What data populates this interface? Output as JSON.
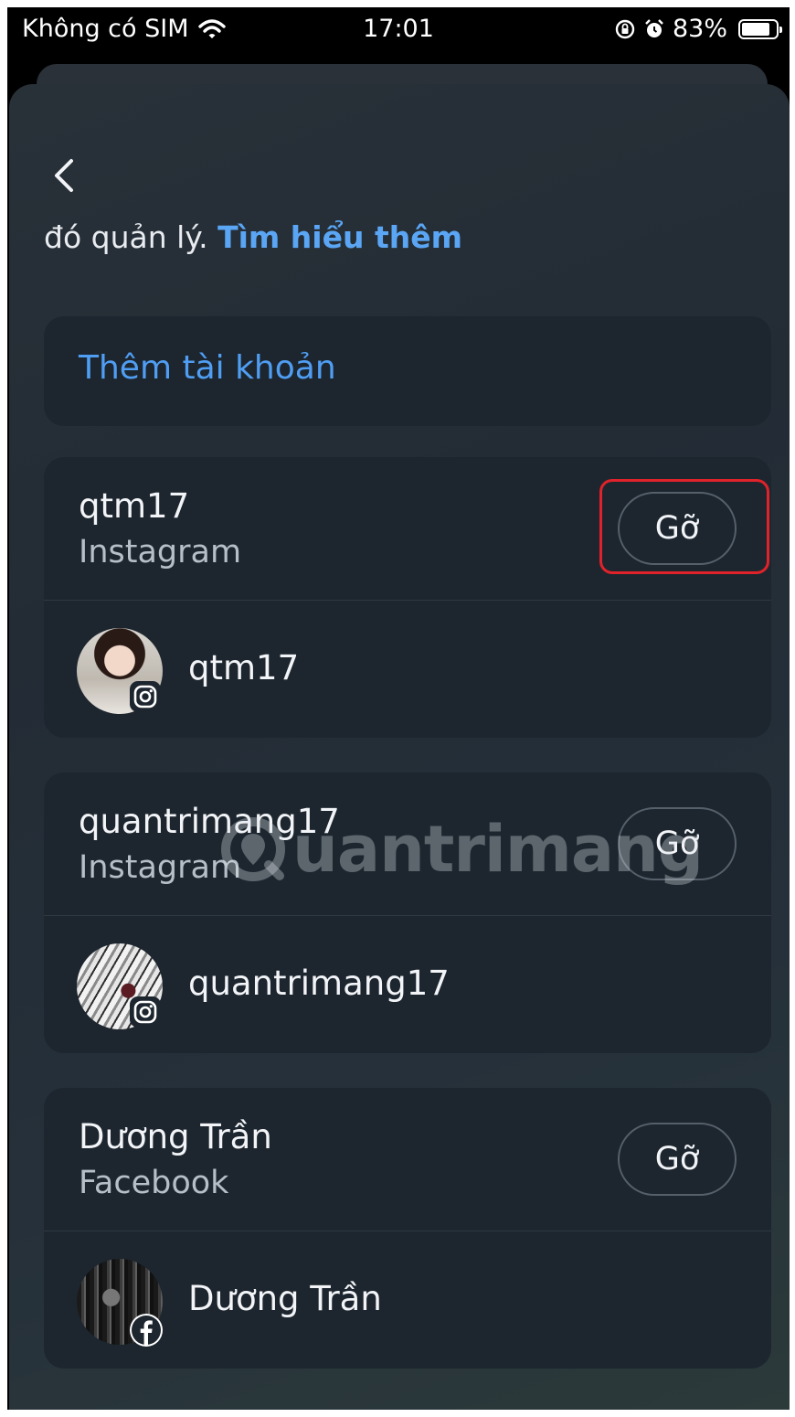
{
  "status_bar": {
    "carrier": "Không có SIM",
    "time": "17:01",
    "battery_percent": "83%",
    "battery_level": 0.83
  },
  "intro": {
    "text": "đó quản lý.",
    "link": "Tìm hiểu thêm"
  },
  "add_account": {
    "label": "Thêm tài khoản"
  },
  "accounts": [
    {
      "name": "qtm17",
      "platform": "Instagram",
      "remove_label": "Gỡ",
      "profile_name": "qtm17",
      "badge_icon": "instagram-icon"
    },
    {
      "name": "quantrimang17",
      "platform": "Instagram",
      "remove_label": "Gỡ",
      "profile_name": "quantrimang17",
      "badge_icon": "instagram-icon"
    },
    {
      "name": "Dương Trần",
      "platform": "Facebook",
      "remove_label": "Gỡ",
      "profile_name": "Dương Trần",
      "badge_icon": "facebook-icon"
    }
  ],
  "watermark": {
    "text": "uantrimang"
  },
  "colors": {
    "link": "#4f9ef3",
    "card": "#1d262f",
    "highlight": "#e0222a"
  }
}
